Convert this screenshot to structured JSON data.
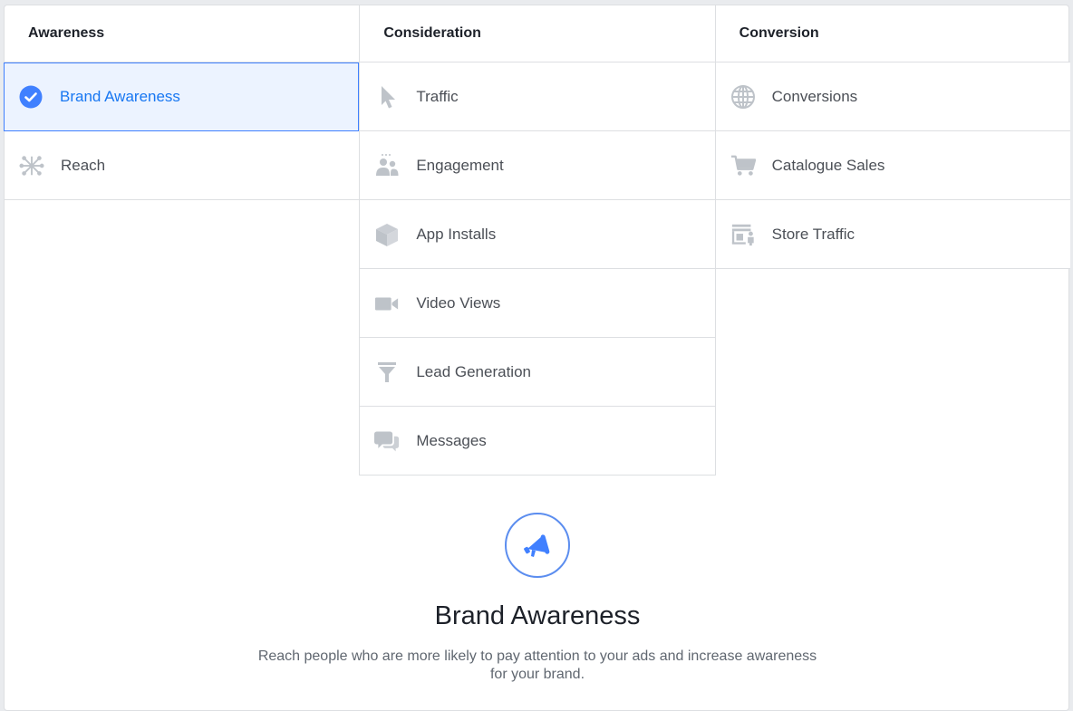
{
  "columns": {
    "awareness": {
      "header": "Awareness",
      "items": [
        {
          "label": "Brand Awareness",
          "icon": "check-circle-icon",
          "selected": true
        },
        {
          "label": "Reach",
          "icon": "reach-network-icon",
          "selected": false
        }
      ]
    },
    "consideration": {
      "header": "Consideration",
      "items": [
        {
          "label": "Traffic",
          "icon": "cursor-icon"
        },
        {
          "label": "Engagement",
          "icon": "people-icon"
        },
        {
          "label": "App Installs",
          "icon": "box-icon"
        },
        {
          "label": "Video Views",
          "icon": "video-camera-icon"
        },
        {
          "label": "Lead Generation",
          "icon": "funnel-icon"
        },
        {
          "label": "Messages",
          "icon": "chat-bubbles-icon"
        }
      ]
    },
    "conversion": {
      "header": "Conversion",
      "items": [
        {
          "label": "Conversions",
          "icon": "globe-icon"
        },
        {
          "label": "Catalogue Sales",
          "icon": "shopping-cart-icon"
        },
        {
          "label": "Store Traffic",
          "icon": "store-icon"
        }
      ]
    }
  },
  "detail": {
    "icon": "megaphone-icon",
    "title": "Brand Awareness",
    "description": "Reach people who are more likely to pay attention to your ads and increase awareness for your brand."
  },
  "colors": {
    "accent": "#1877f2",
    "selected_bg": "#ecf3ff",
    "icon_gray": "#bec3c9"
  }
}
